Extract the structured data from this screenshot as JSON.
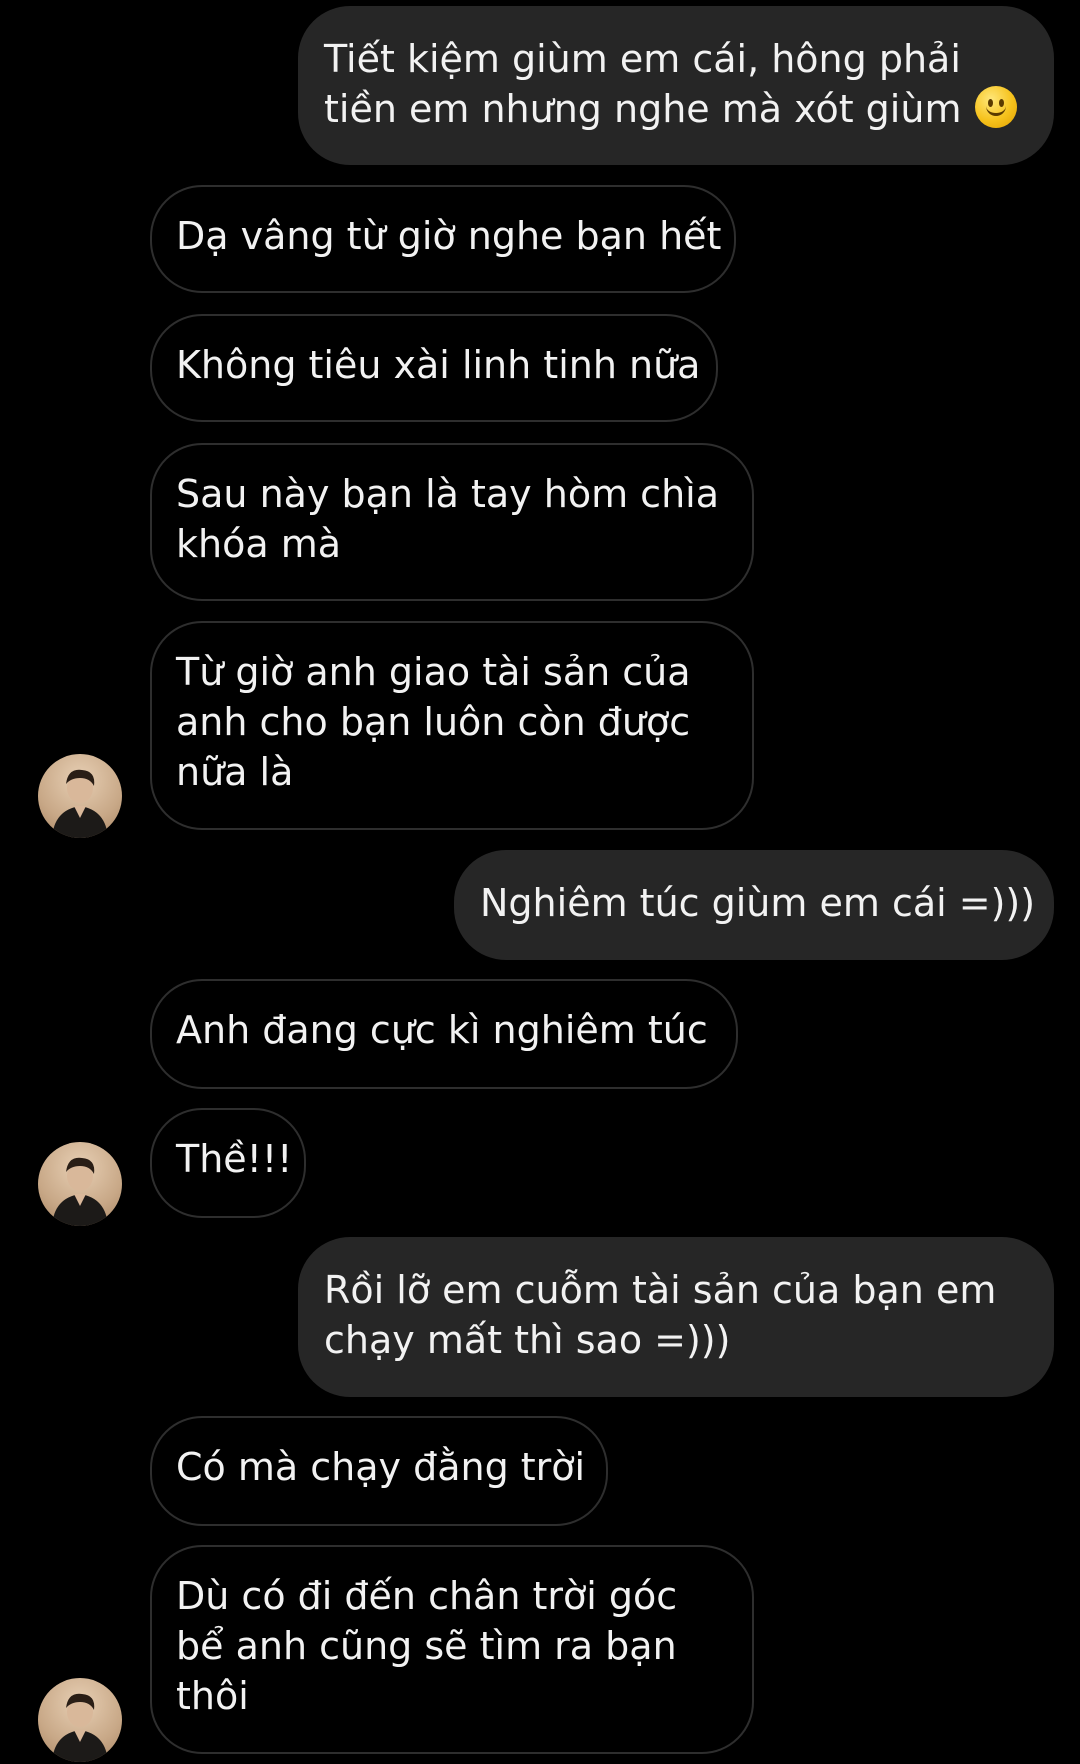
{
  "conversation": {
    "messages": [
      {
        "sender": "me",
        "lines": [
          "Tiết kiệm giùm em cái, hông phải",
          "tiền em nhưng nghe mà xót giùm"
        ],
        "emoji": "slightly-smiling-face-icon"
      },
      {
        "sender": "them",
        "lines": [
          "Dạ vâng từ giờ nghe bạn hết"
        ]
      },
      {
        "sender": "them",
        "lines": [
          "Không tiêu xài linh tinh nữa"
        ]
      },
      {
        "sender": "them",
        "lines": [
          "Sau này bạn là tay hòm chìa",
          "khóa mà"
        ]
      },
      {
        "sender": "them",
        "lines": [
          "Từ giờ anh giao tài sản của",
          "anh cho bạn luôn còn được",
          "nữa là"
        ]
      },
      {
        "sender": "me",
        "lines": [
          "Nghiêm túc giùm em cái =)))"
        ]
      },
      {
        "sender": "them",
        "lines": [
          "Anh đang cực kì nghiêm túc"
        ]
      },
      {
        "sender": "them",
        "lines": [
          "Thề!!!"
        ]
      },
      {
        "sender": "me",
        "lines": [
          "Rồi lỡ em cuỗm tài sản của bạn em",
          "chạy mất thì sao =)))"
        ]
      },
      {
        "sender": "them",
        "lines": [
          "Có mà chạy đằng trời"
        ]
      },
      {
        "sender": "them",
        "lines": [
          "Dù có đi đến chân trời góc",
          "bể anh cũng sẽ tìm ra bạn",
          "thôi"
        ]
      }
    ]
  },
  "colors": {
    "background": "#000000",
    "sent_bubble": "#262626",
    "received_border": "#2e2e2e",
    "text": "#f2f2f2"
  }
}
